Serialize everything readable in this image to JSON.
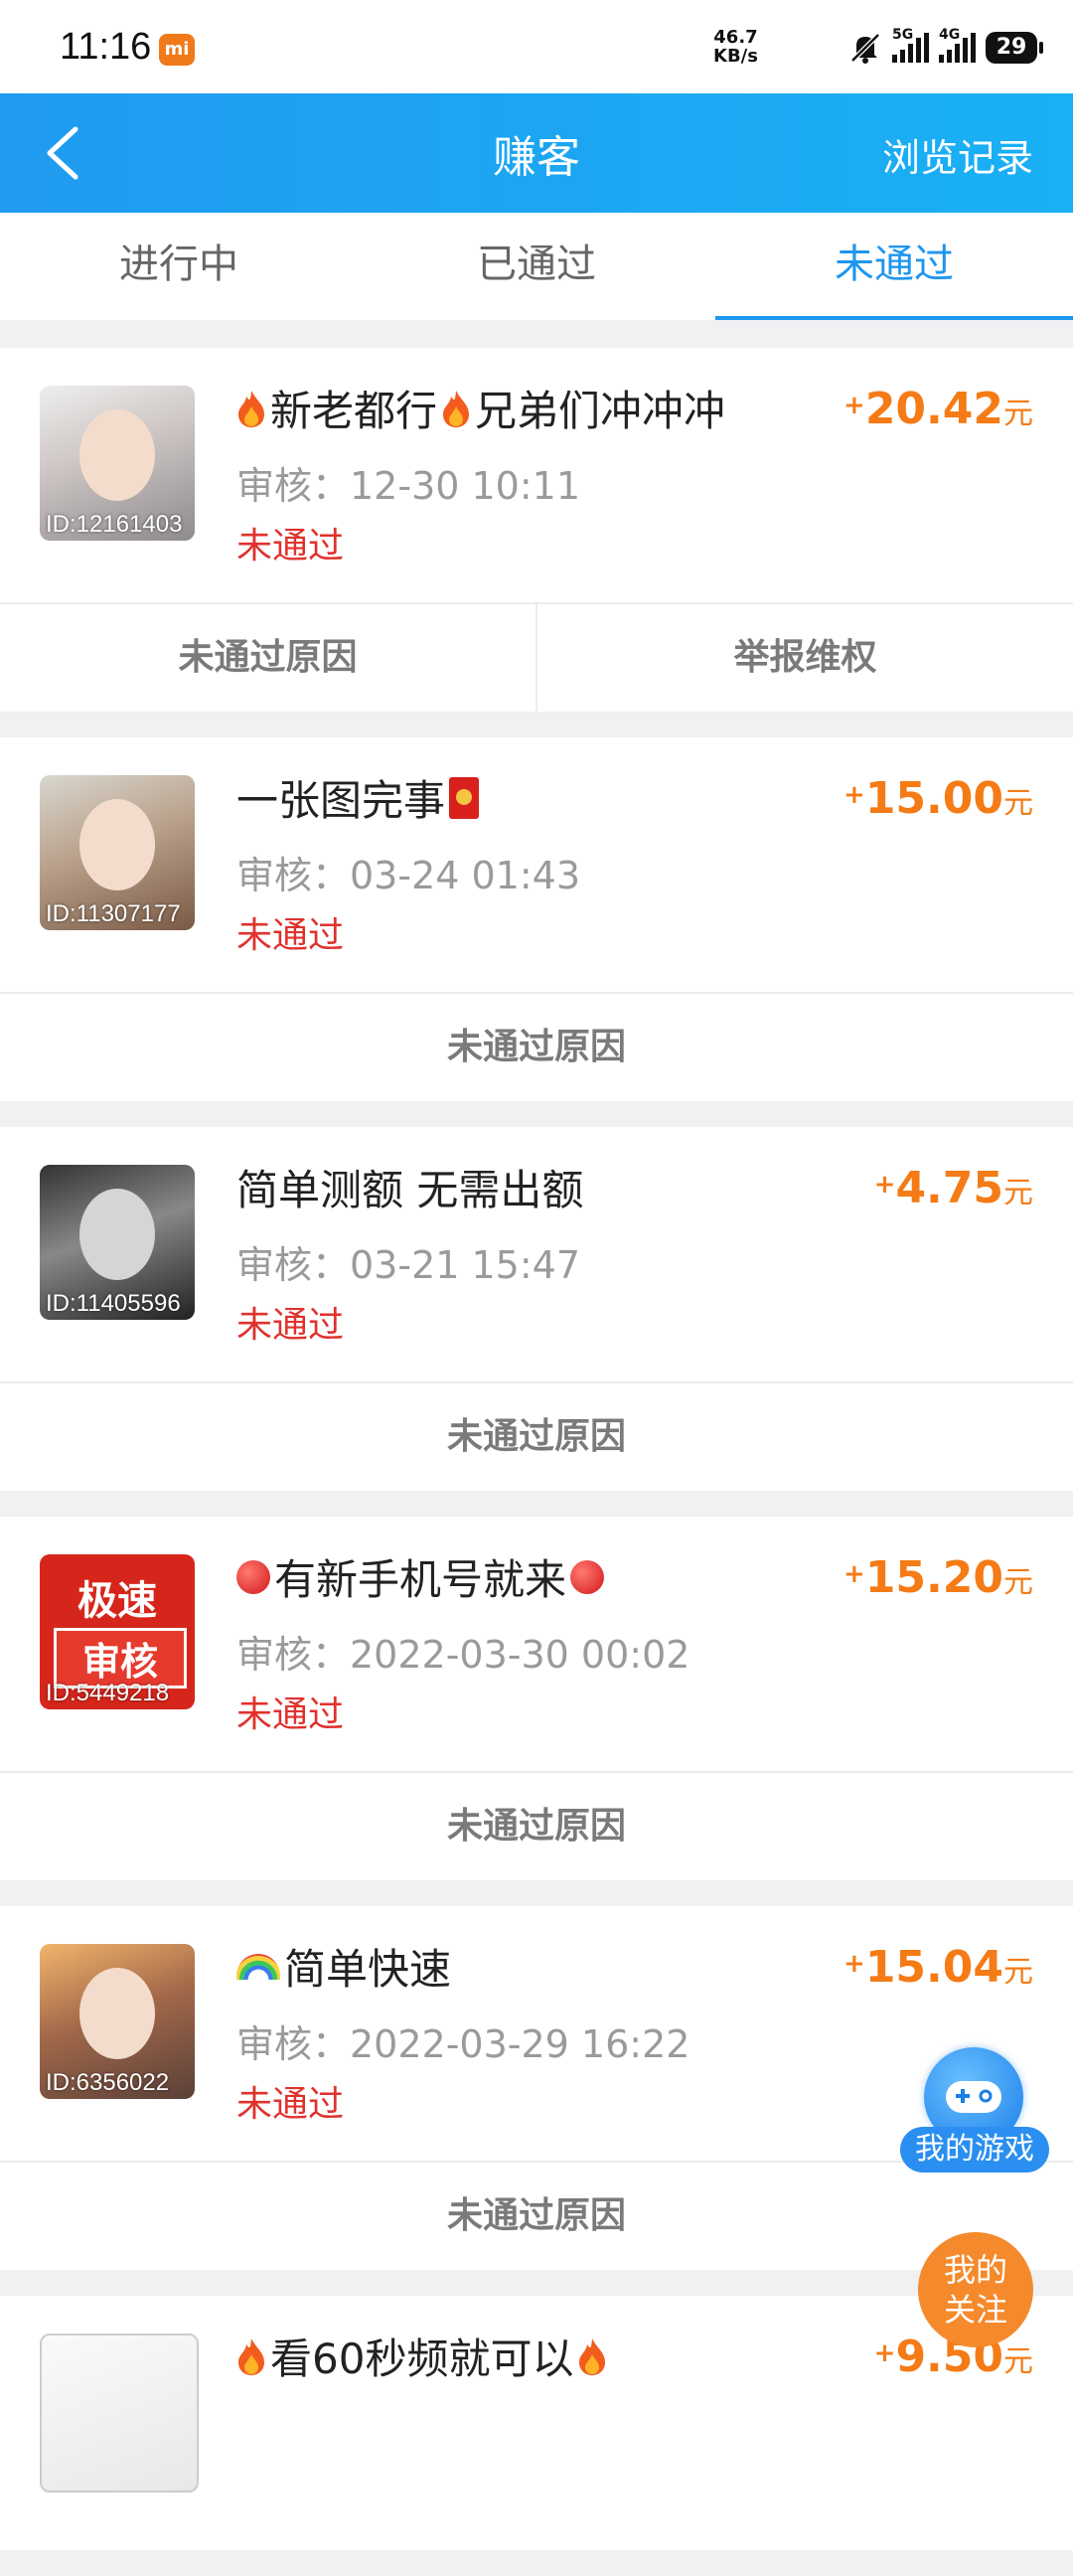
{
  "status_bar": {
    "time": "11:16",
    "net_speed_value": "46.7",
    "net_speed_unit": "KB/s",
    "signal1_label": "5G",
    "signal2_label": "4G",
    "battery": "29"
  },
  "header": {
    "title": "赚客",
    "history_label": "浏览记录"
  },
  "tabs": [
    {
      "label": "进行中"
    },
    {
      "label": "已通过"
    },
    {
      "label": "未通过"
    }
  ],
  "tasks": [
    {
      "id_label": "ID:12161403",
      "title": "新老都行",
      "title2": "兄弟们冲冲冲",
      "review_time": "审核：12-30 10:11",
      "status": "未通过",
      "plus": "+",
      "amount": "20.42",
      "unit": "元",
      "actions": [
        "未通过原因",
        "举报维权"
      ]
    },
    {
      "id_label": "ID:11307177",
      "title": "一张图完事",
      "review_time": "审核：03-24 01:43",
      "status": "未通过",
      "plus": "+",
      "amount": "15.00",
      "unit": "元",
      "actions": [
        "未通过原因"
      ]
    },
    {
      "id_label": "ID:11405596",
      "title": "简单测额 无需出额",
      "review_time": "审核：03-21 15:47",
      "status": "未通过",
      "plus": "+",
      "amount": "4.75",
      "unit": "元",
      "actions": [
        "未通过原因"
      ]
    },
    {
      "id_label": "ID:5449218",
      "avatar_text1": "极速",
      "avatar_text2": "审核",
      "title": "有新手机号就来",
      "review_time": "审核：2022-03-30 00:02",
      "status": "未通过",
      "plus": "+",
      "amount": "15.20",
      "unit": "元",
      "actions": [
        "未通过原因"
      ]
    },
    {
      "id_label": "ID:6356022",
      "title": "简单快速",
      "review_time": "审核：2022-03-29 16:22",
      "status": "未通过",
      "plus": "+",
      "amount": "15.04",
      "unit": "元",
      "actions": [
        "未通过原因"
      ]
    },
    {
      "title": "看60秒频就可以",
      "plus": "+",
      "amount": "9.50",
      "unit": "元"
    }
  ],
  "floating": {
    "my_games": "我的游戏",
    "my_follow_line1": "我的",
    "my_follow_line2": "关注"
  }
}
